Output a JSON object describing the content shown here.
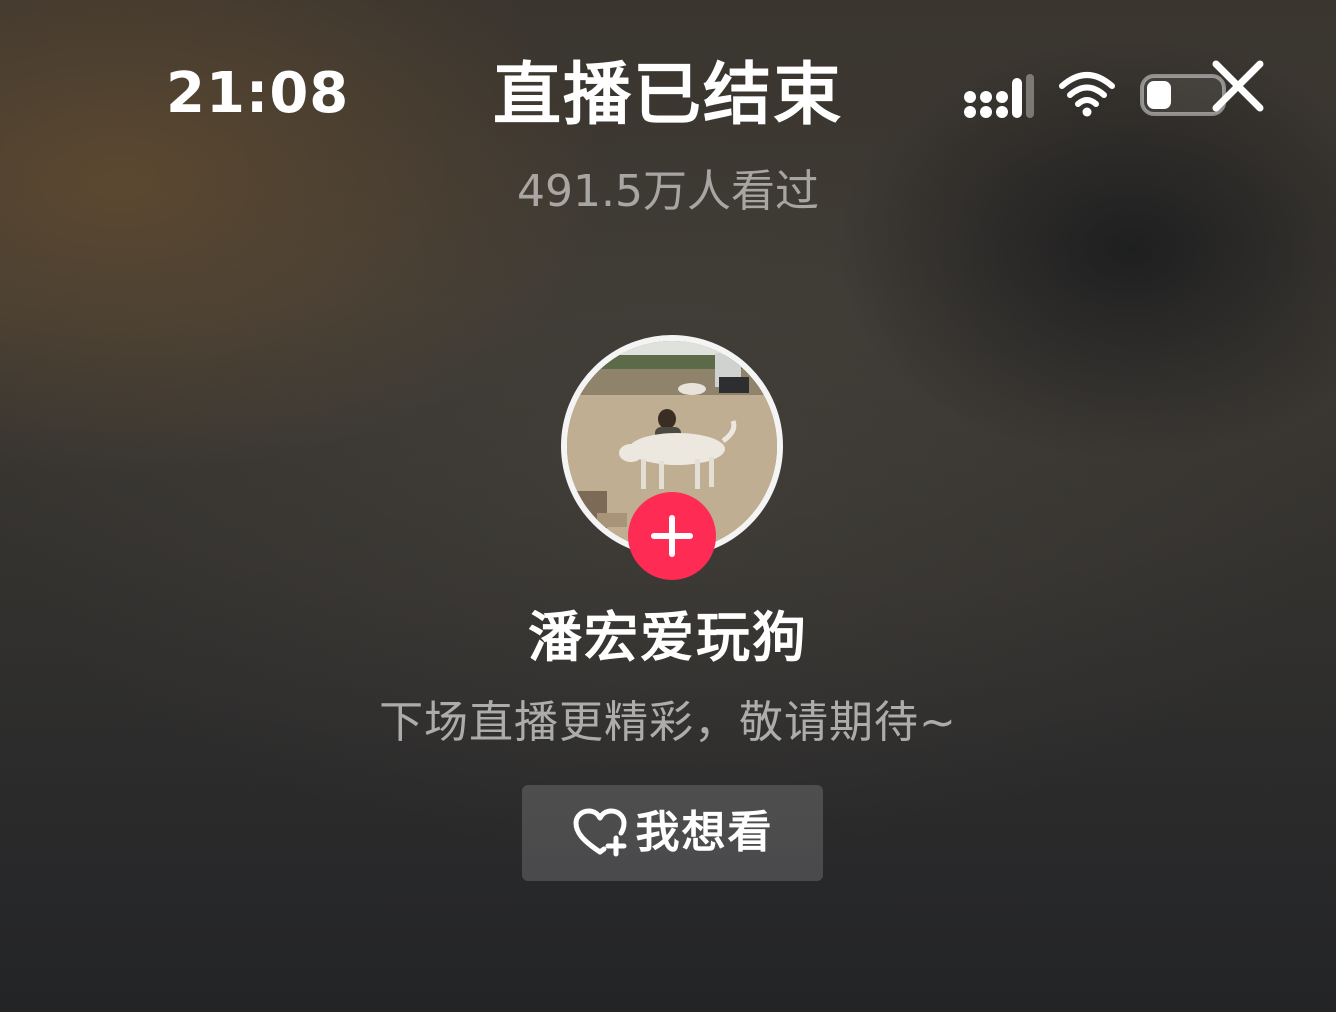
{
  "status_bar": {
    "time": "21:08"
  },
  "header": {
    "title": "直播已结束",
    "viewer_count": "491.5万人看过"
  },
  "streamer": {
    "name": "潘宏爱玩狗",
    "message": "下场直播更精彩，敬请期待~"
  },
  "actions": {
    "want_to_watch_label": "我想看"
  },
  "icons": {
    "signal": "signal-icon",
    "wifi": "wifi-icon",
    "battery": "battery-icon",
    "close": "close-icon",
    "follow": "plus-icon",
    "want": "heart-plus-icon"
  },
  "colors": {
    "follow_button": "#fe2c55",
    "text_primary": "#ffffff"
  }
}
